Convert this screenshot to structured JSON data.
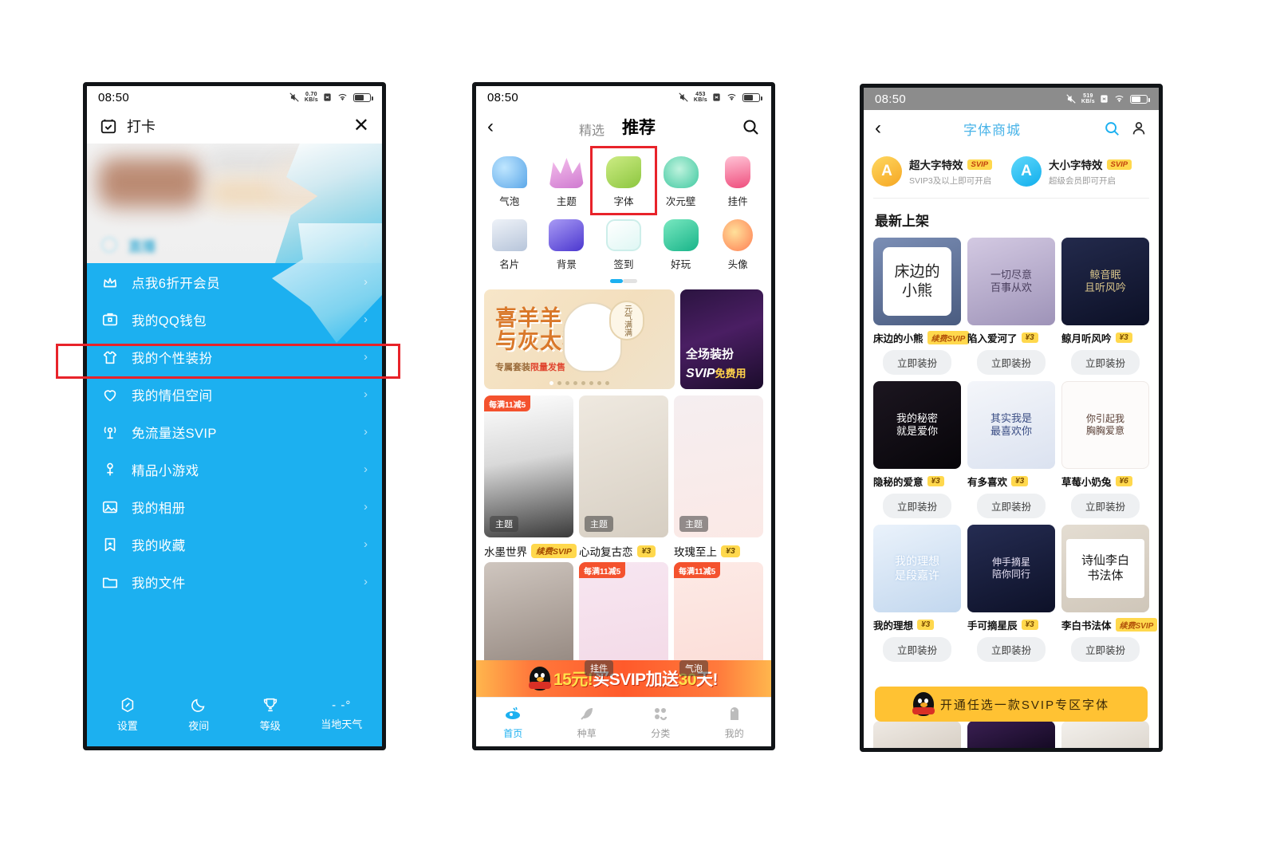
{
  "phone1": {
    "status": {
      "time": "08:50",
      "net_speed": "0.70",
      "net_unit": "KB/s"
    },
    "header": {
      "title": "打卡",
      "close_label": "✕"
    },
    "banner": {
      "live_label": "直播"
    },
    "rows": [
      {
        "icon": "crown-icon",
        "label": "点我6折开会员"
      },
      {
        "icon": "wallet-icon",
        "label": "我的QQ钱包"
      },
      {
        "icon": "tshirt-icon",
        "label": "我的个性装扮"
      },
      {
        "icon": "heart-icon",
        "label": "我的情侣空间"
      },
      {
        "icon": "signal-icon",
        "label": "免流量送SVIP"
      },
      {
        "icon": "game-icon",
        "label": "精品小游戏"
      },
      {
        "icon": "album-icon",
        "label": "我的相册"
      },
      {
        "icon": "bookmark-icon",
        "label": "我的收藏"
      },
      {
        "icon": "folder-icon",
        "label": "我的文件"
      }
    ],
    "footer": [
      {
        "icon": "settings-icon",
        "label": "设置"
      },
      {
        "icon": "moon-icon",
        "label": "夜间"
      },
      {
        "icon": "trophy-icon",
        "label": "等级"
      },
      {
        "icon": "weather-icon",
        "label": "当地天气",
        "value": "- -°"
      }
    ],
    "highlight": "我的个性装扮"
  },
  "phone2": {
    "status": {
      "time": "08:50",
      "net_speed": "453",
      "net_unit": "KB/s"
    },
    "nav": {
      "back": "‹",
      "tab_inactive": "精选",
      "tab_active": "推荐",
      "search_icon": "search-icon"
    },
    "categories": [
      {
        "label": "气泡",
        "color1": "#8fd0f5",
        "color2": "#5aa6e8"
      },
      {
        "label": "主题",
        "color1": "#f0a8e0",
        "color2": "#d87fd0"
      },
      {
        "label": "字体",
        "color1": "#b8e06a",
        "color2": "#8cc63f",
        "highlighted": true
      },
      {
        "label": "次元壁",
        "color1": "#9ee6c8",
        "color2": "#58cfa8"
      },
      {
        "label": "挂件",
        "color1": "#f7a8c0",
        "color2": "#ef5f8a"
      },
      {
        "label": "名片",
        "color1": "#cfd8e8",
        "color2": "#9fb0cc"
      },
      {
        "label": "背景",
        "color1": "#9a8cf0",
        "color2": "#5b48d8"
      },
      {
        "label": "签到",
        "color1": "#7fe0d8",
        "color2": "#35c2bb"
      },
      {
        "label": "好玩",
        "color1": "#63dcb8",
        "color2": "#22b98e"
      },
      {
        "label": "头像",
        "color1": "#ffcf6e",
        "color2": "#ff8a5c"
      }
    ],
    "banner_main": {
      "line1": "喜羊羊",
      "line2": "与灰太狼",
      "sub_a": "专属套装",
      "sub_b": "限量发售",
      "bubble": "元气满满"
    },
    "banner_side": {
      "line1": "全场装扮",
      "line2": "SVIP",
      "line2_suffix": "免费用"
    },
    "products": [
      {
        "name": "水墨世界",
        "price": "续费SVIP",
        "is_svip": true,
        "tag": "主题",
        "badge": ""
      },
      {
        "name": "心动复古恋",
        "price": "¥3",
        "is_svip": false,
        "tag": "主题",
        "badge": ""
      },
      {
        "name": "玫瑰至上",
        "price": "¥3",
        "is_svip": false,
        "tag": "主题",
        "badge": ""
      },
      {
        "name": "",
        "price": "",
        "is_svip": false,
        "tag": "",
        "badge": ""
      },
      {
        "name": "",
        "price": "",
        "is_svip": false,
        "tag": "挂件",
        "badge": "每满11减5"
      },
      {
        "name": "",
        "price": "",
        "is_svip": false,
        "tag": "气泡",
        "badge": "每满11减5"
      }
    ],
    "product_badge_first": "每满11减5",
    "promo": {
      "pre": "15元!",
      "mid": "买SVIP加送",
      "days": "30",
      "post": "天!"
    },
    "tabbar": [
      {
        "label": "首页",
        "icon": "home-icon",
        "active": true
      },
      {
        "label": "种草",
        "icon": "leaf-icon",
        "active": false
      },
      {
        "label": "分类",
        "icon": "grid-icon",
        "active": false
      },
      {
        "label": "我的",
        "icon": "profile-icon",
        "active": false
      }
    ]
  },
  "phone3": {
    "status": {
      "time": "08:50",
      "net_speed": "519",
      "net_unit": "KB/s"
    },
    "nav": {
      "back": "‹",
      "title": "字体商城",
      "search_icon": "search-icon",
      "profile_icon": "profile-icon"
    },
    "effects": [
      {
        "title": "超大字特效",
        "vip": "SVIP",
        "sub": "SVIP3及以上即可开启",
        "glyph": "A",
        "color1": "#ffd049",
        "color2": "#f5a623"
      },
      {
        "title": "大小字特效",
        "vip": "SVIP",
        "sub": "超级会员即可开启",
        "glyph": "A",
        "color1": "#4fd3f7",
        "color2": "#1cb0f0"
      }
    ],
    "section_title": "最新上架",
    "fonts": [
      {
        "name": "床边的小熊",
        "price": "续费SVIP",
        "is_svip": true,
        "button": "立即装扮",
        "preview": "床边的\n小熊",
        "bg1": "#6b7fa6",
        "bg2": "#4a5c80",
        "fg": "#222222",
        "card": true
      },
      {
        "name": "陷入爱河了",
        "price": "¥3",
        "is_svip": false,
        "button": "立即装扮",
        "preview": "一切尽意\n百事从欢",
        "bg1": "#c9c0d8",
        "bg2": "#9e93b8",
        "fg": "#4a3f5e",
        "card": false
      },
      {
        "name": "鲸月听风吟",
        "price": "¥3",
        "is_svip": false,
        "button": "立即装扮",
        "preview": "鲸音眠\n且听风吟",
        "bg1": "#1d2340",
        "bg2": "#0c1026",
        "fg": "#d8c48a",
        "card": false
      },
      {
        "name": "隐秘的爱意",
        "price": "¥3",
        "is_svip": false,
        "button": "立即装扮",
        "preview": "我的秘密\n就是爱你",
        "bg1": "#17131c",
        "bg2": "#0a080d",
        "fg": "#ffffff",
        "card": false
      },
      {
        "name": "有多喜欢",
        "price": "¥3",
        "is_svip": false,
        "button": "立即装扮",
        "preview": "其实我是\n最喜欢你",
        "bg1": "#eef1f7",
        "bg2": "#dbe2f0",
        "fg": "#3a4d84",
        "card": false
      },
      {
        "name": "草莓小奶兔",
        "price": "¥6",
        "is_svip": false,
        "button": "立即装扮",
        "preview": "你引起我\n胸胸爱意",
        "bg1": "#ffffff",
        "bg2": "#f7f4f2",
        "fg": "#5a4036",
        "card": false
      },
      {
        "name": "我的理想",
        "price": "¥3",
        "is_svip": false,
        "button": "立即装扮",
        "preview": "我的理想\n是段嘉许",
        "bg1": "#dfe9f6",
        "bg2": "#c2d7ee",
        "fg": "#ffffff",
        "card": false
      },
      {
        "name": "手可摘星辰",
        "price": "¥3",
        "is_svip": false,
        "button": "立即装扮",
        "preview": "伸手摘星\n陪你同行",
        "bg1": "#1b2040",
        "bg2": "#0d1128",
        "fg": "#e8e2f5",
        "card": false
      },
      {
        "name": "李白书法体",
        "price": "续费SVIP",
        "is_svip": true,
        "button": "立即装扮",
        "preview": "诗仙李白\n书法体",
        "bg1": "#ded7cc",
        "bg2": "#cfc6b9",
        "fg": "#1a1a1a",
        "card": true
      }
    ],
    "cta": {
      "label": "开通任选一款SVIP专区字体",
      "icon": "qq-penguin-icon"
    }
  }
}
